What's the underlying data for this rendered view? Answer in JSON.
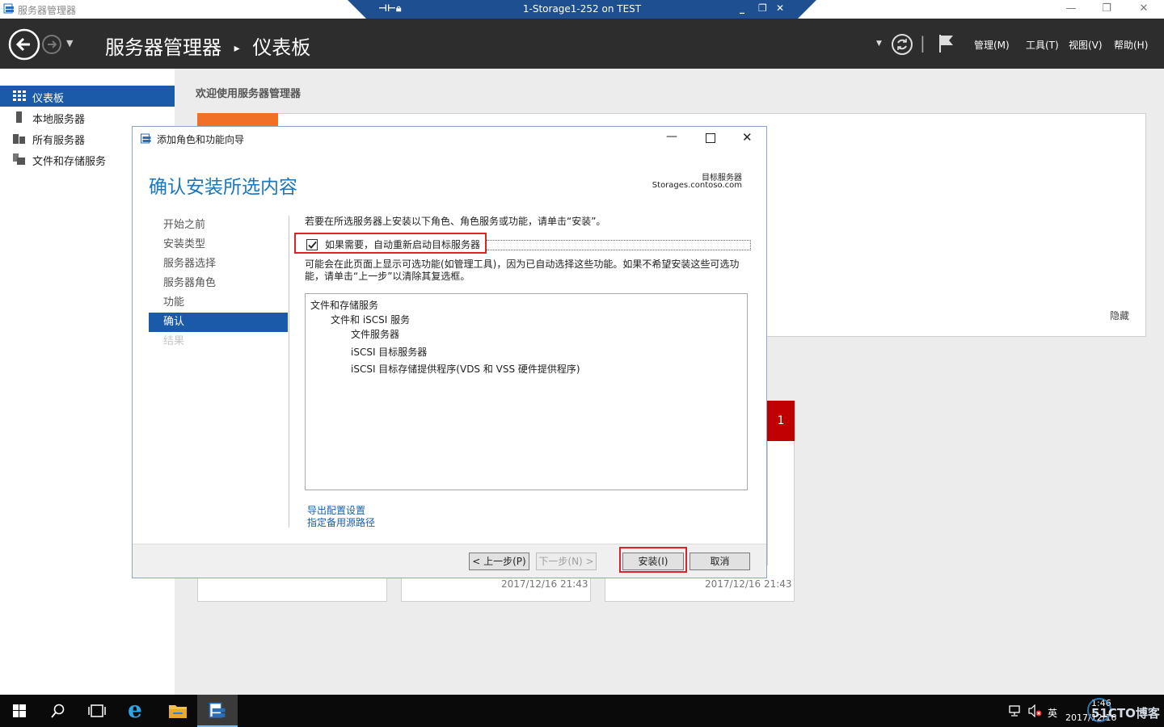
{
  "window": {
    "title": "服务器管理器"
  },
  "rdp": {
    "title": "1-Storage1-252 on TEST"
  },
  "header": {
    "breadcrumb_root": "服务器管理器",
    "breadcrumb_sep": "▸",
    "breadcrumb_page": "仪表板",
    "menus": [
      "管理(M)",
      "工具(T)",
      "视图(V)",
      "帮助(H)"
    ]
  },
  "nav": {
    "items": [
      {
        "label": "仪表板",
        "icon": "dashboard-icon",
        "active": true
      },
      {
        "label": "本地服务器",
        "icon": "server-icon"
      },
      {
        "label": "所有服务器",
        "icon": "servers-icon"
      },
      {
        "label": "文件和存储服务",
        "icon": "storage-icon"
      }
    ]
  },
  "main": {
    "welcome": "欢迎使用服务器管理器",
    "hide": "隐藏",
    "badge": "1",
    "tile_dates": [
      "2017/12/16 21:43",
      "2017/12/16 21:43"
    ]
  },
  "dialog": {
    "title": "添加角色和功能向导",
    "heading": "确认安装所选内容",
    "target_label": "目标服务器",
    "target_value": "Storages.contoso.com",
    "steps": [
      "开始之前",
      "安装类型",
      "服务器选择",
      "服务器角色",
      "功能",
      "确认",
      "结果"
    ],
    "instruction": "若要在所选服务器上安装以下角色、角色服务或功能，请单击“安装”。",
    "restart_label": "如果需要，自动重新启动目标服务器",
    "restart_checked": true,
    "note_line1": "可能会在此页面上显示可选功能(如管理工具)，因为已自动选择这些功能。如果不希望安装这些可选功",
    "note_line2": "能，请单击“上一步”以清除其复选框。",
    "features": [
      {
        "label": "文件和存储服务",
        "level": 0
      },
      {
        "label": "文件和 iSCSI 服务",
        "level": 1
      },
      {
        "label": "文件服务器",
        "level": 2
      },
      {
        "label": "iSCSI 目标服务器",
        "level": 2
      },
      {
        "label": "iSCSI 目标存储提供程序(VDS 和 VSS 硬件提供程序)",
        "level": 2
      }
    ],
    "link_export": "导出配置设置",
    "link_source": "指定备用源路径",
    "btn_prev": "< 上一步(P)",
    "btn_next": "下一步(N) >",
    "btn_install": "安装(I)",
    "btn_cancel": "取消"
  },
  "taskbar": {
    "ime": "英",
    "time": "1:46",
    "date": "2017/12/16",
    "watermark": "51CTO博客"
  },
  "colors": {
    "header_bg": "#2d2d2d",
    "nav_active": "#1a5aa8",
    "heading": "#1b77bc",
    "highlight": "#e0202a",
    "badge": "#c00000",
    "orange": "#f07126"
  }
}
